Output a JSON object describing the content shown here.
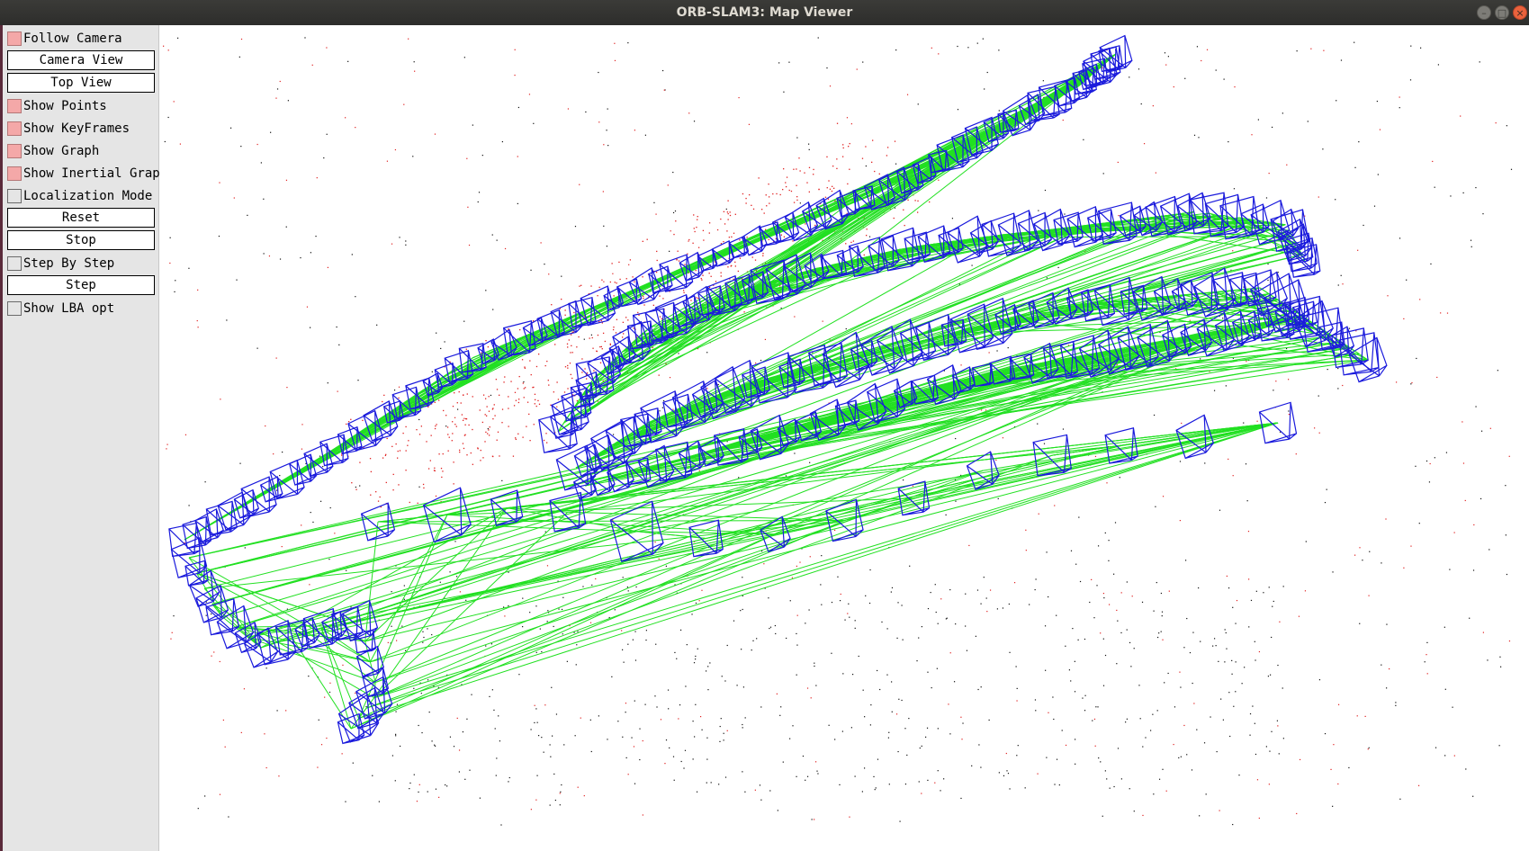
{
  "window": {
    "title": "ORB-SLAM3: Map Viewer",
    "controls": [
      "minimize-icon",
      "maximize-icon",
      "close-icon"
    ]
  },
  "panel": {
    "follow_camera": {
      "label": "Follow Camera",
      "checked": true
    },
    "camera_view_label": "Camera View",
    "top_view_label": "Top View",
    "show_points": {
      "label": "Show Points",
      "checked": true
    },
    "show_keyframes": {
      "label": "Show KeyFrames",
      "checked": true
    },
    "show_graph": {
      "label": "Show Graph",
      "checked": true
    },
    "show_inertial_graph": {
      "label": "Show Inertial Graph",
      "checked": true
    },
    "localization_mode": {
      "label": "Localization Mode",
      "checked": false
    },
    "reset_label": "Reset",
    "stop_label": "Stop",
    "step_by_step": {
      "label": "Step By Step",
      "checked": false
    },
    "step_label": "Step",
    "show_lba_opt": {
      "label": "Show LBA opt",
      "checked": false
    }
  },
  "colors": {
    "keyframe": "#1a1adc",
    "graph_edge": "#22e022",
    "map_point_active": "#e02020",
    "map_point": "#101010",
    "checkbox_on": "#f4a8a8",
    "titlebar": "#2d2d2b"
  }
}
